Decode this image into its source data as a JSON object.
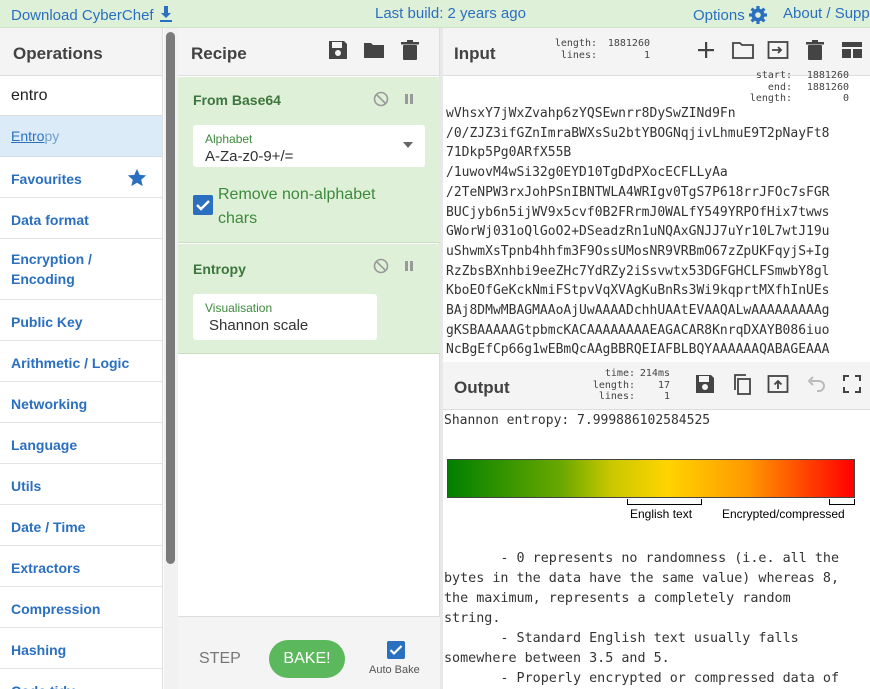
{
  "banner": {
    "download": "Download CyberChef",
    "last_build": "Last build: 2 years ago",
    "options": "Options",
    "about": "About / Suppo",
    "colors": {
      "bg": "#dff0d8",
      "link": "#2a6fc0"
    }
  },
  "operations": {
    "title": "Operations",
    "search_value": "entro",
    "result_match": "Entro",
    "result_rest": "py",
    "categories": [
      "Favourites",
      "Data format",
      "Encryption / Encoding",
      "Public Key",
      "Arithmetic / Logic",
      "Networking",
      "Language",
      "Utils",
      "Date / Time",
      "Extractors",
      "Compression",
      "Hashing",
      "Code tidy"
    ]
  },
  "recipe": {
    "title": "Recipe",
    "ops": [
      {
        "name": "From Base64",
        "alphabet_label": "Alphabet",
        "alphabet_value": "A-Za-z0-9+/=",
        "checkbox_label_1": "Remove non-alphabet",
        "checkbox_label_2": "chars"
      },
      {
        "name": "Entropy",
        "vis_label": "Visualisation",
        "vis_value": "Shannon scale"
      }
    ],
    "step": "STEP",
    "bake": "BAKE!",
    "auto_bake": "Auto Bake"
  },
  "input": {
    "title": "Input",
    "length_label": "length:",
    "length_value": "1881260",
    "lines_label": "lines:",
    "lines_value": "1",
    "start_label": "start:",
    "start_value": "1881260",
    "end_label": "end:",
    "end_value": "1881260",
    "sel_length_label": "length:",
    "sel_length_value": "0",
    "text": [
      "wVhsxY7jWxZvahp6zYQSEwnrr8DySwZINd9Fn",
      "/0/ZJZ3ifGZnImraBWXsSu2btYBOGNqjivLhmuE9T2pNayFt8",
      "71Dkp5Pg0ARfX55B",
      "/1uwovM4wSi32g0EYD10TgDdPXocECFLLyAa",
      "/2TeNPW3rxJohPSnIBNTWLA4WRIgv0TgS7P618rrJFOc7sFGR",
      "BUCjyb6n5ijWV9x5cvf0B2FRrmJ0WALfY549YRPOfHix7twws",
      "GWorWj031oQlGoO2+DSeadzRn1uNQAxGNJJ7uYr10L7wtJ19u",
      "uShwmXsTpnb4hhfm3F9OssUMosNR9VRBmO67zZpUKFqyjS+Ig",
      "RzZbsBXnhbi9eeZHc7YdRZy2iSsvwtx53DGFGHCLFSmwbY8gl",
      "KboEOfGeKckNmiFStpvVqXVAgKuBnRs3Wi9kqprtMXfhInUEs",
      "BAj8DMwMBAGMAAoAjUwAAAADchhUAAtEVAAQALwAAAAAAAAAg",
      "gKSBAAAAAGtpbmcKACAAAAAAAAEAGACAR8KnrqDXAYB086iuo",
      "NcBgEfCp66g1wEBmQcAAgBBRQEIAFBLBQYAAAAAAQABAGEAAA"
    ]
  },
  "output": {
    "title": "Output",
    "time_label": "time:",
    "time_value": "214ms",
    "length_label": "length:",
    "length_value": "17",
    "lines_label": "lines:",
    "lines_value": "1",
    "entropy_text": "Shannon entropy: 7.999886102584525",
    "english_label": "English text",
    "encrypted_label": "Encrypted/compressed",
    "desc": [
      "       - 0 represents no randomness (i.e. all the",
      "bytes in the data have the same value) whereas 8,",
      "the maximum, represents a completely random",
      "string.",
      "       - Standard English text usually falls",
      "somewhere between 3.5 and 5.",
      "       - Properly encrypted or compressed data of"
    ]
  }
}
